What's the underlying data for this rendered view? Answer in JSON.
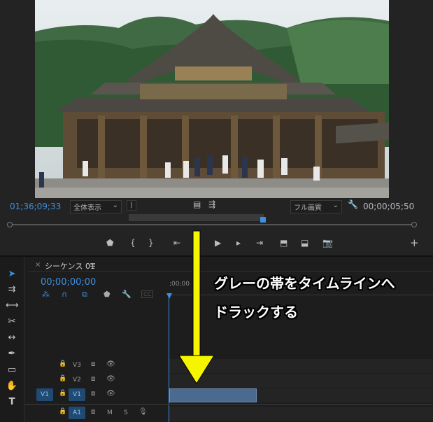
{
  "monitor": {
    "playhead_timecode": "01;36;09;33",
    "zoom_select": "全体表示",
    "resolution_select": "フル画質",
    "duration_timecode": "00;00;05;50",
    "transport_icons": [
      "marker-icon",
      "in-point-icon",
      "out-point-icon",
      "go-to-in-icon",
      "step-back-icon",
      "play-icon",
      "step-forward-icon",
      "go-to-out-icon",
      "insert-icon",
      "overwrite-icon",
      "export-frame-icon",
      "add-button-icon"
    ]
  },
  "timeline": {
    "close_label": "×",
    "sequence_tab": "シーケンス 01",
    "menu_glyph": "≡",
    "timecode": "00;00;00;00",
    "ruler_label": ";00;00",
    "tracks": [
      {
        "name": "V3",
        "source": "",
        "type": "video"
      },
      {
        "name": "V2",
        "source": "",
        "type": "video"
      },
      {
        "name": "V1",
        "source": "V1",
        "type": "video"
      },
      {
        "name": "A1",
        "source": "",
        "type": "audio",
        "m": "M",
        "s": "S"
      }
    ],
    "tools": [
      "selection-tool-icon",
      "track-select-tool-icon",
      "ripple-edit-tool-icon",
      "razor-tool-icon",
      "slip-tool-icon",
      "pen-tool-icon",
      "rectangle-tool-icon",
      "hand-tool-icon",
      "type-tool-icon"
    ],
    "type_tool_label": "T"
  },
  "annotation": {
    "line1": "グレーの帯をタイムラインへ",
    "line2": "ドラックする",
    "arrow_color": "#f5f500"
  },
  "colors": {
    "accent_blue": "#3d8fe0",
    "clip_blue": "#4a6a8f"
  }
}
